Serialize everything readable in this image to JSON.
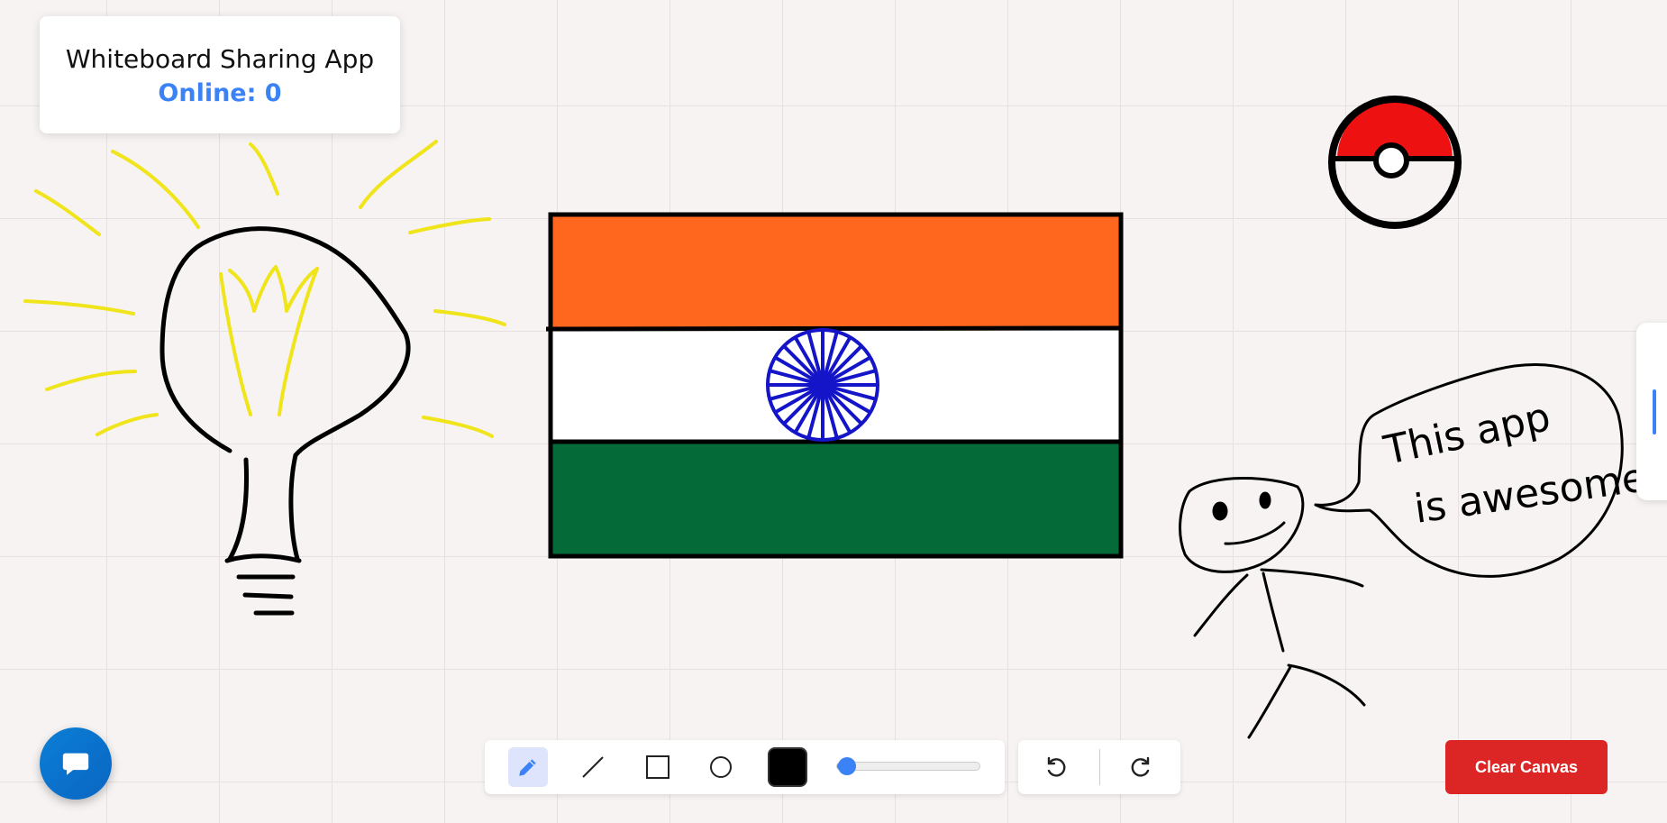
{
  "app": {
    "title": "Whiteboard Sharing App",
    "online_label": "Online: 0"
  },
  "canvas": {
    "drawings": [
      "light-bulb",
      "indian-flag",
      "pokeball",
      "stick-figure",
      "speech-bubble"
    ],
    "speech_bubble_lines": [
      "This app",
      "is awesome"
    ],
    "colors": {
      "saffron": "#ff671f",
      "green": "#046a38",
      "chakra_blue": "#1414c8",
      "bulb_rays": "#f5ea14",
      "pokeball_red": "#ee1111",
      "ink": "#000000"
    }
  },
  "toolbar": {
    "tools": [
      {
        "name": "pencil",
        "icon": "pencil-icon",
        "active": true
      },
      {
        "name": "line",
        "icon": "line-icon",
        "active": false
      },
      {
        "name": "rectangle",
        "icon": "rectangle-icon",
        "active": false
      },
      {
        "name": "circle",
        "icon": "circle-icon",
        "active": false
      }
    ],
    "selected_color": "#000000",
    "brush_size_fraction": 0.07,
    "undo_icon": "undo-icon",
    "redo_icon": "redo-icon"
  },
  "clear_button": {
    "label": "Clear Canvas",
    "color": "#dc2626"
  },
  "chat_button": {
    "icon": "chat-icon",
    "color": "#0a74d0"
  },
  "accent_color": "#3b82f6"
}
